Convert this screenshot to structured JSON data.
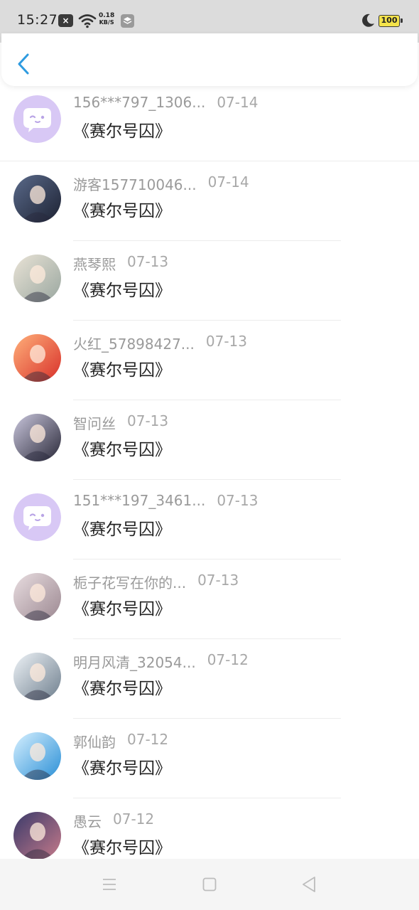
{
  "status_bar": {
    "time": "15:27",
    "speed_value": "0.18",
    "speed_unit": "KB/S",
    "battery": "100",
    "icons": [
      "notification-x-icon",
      "wifi-icon",
      "layers-icon",
      "moon-icon",
      "battery-icon"
    ]
  },
  "header": {
    "back_icon": "chevron-left-icon",
    "accent_color": "#2e9be0"
  },
  "items": [
    {
      "name": "156***797_1306...",
      "date": "07-14",
      "message": "《赛尔号囚》",
      "avatar": "default-chat-avatar"
    },
    {
      "name": "游客157710046...",
      "date": "07-14",
      "message": "《赛尔号囚》",
      "avatar": "user-photo-avatar"
    },
    {
      "name": "燕琴熙",
      "date": "07-13",
      "message": "《赛尔号囚》",
      "avatar": "user-photo-avatar"
    },
    {
      "name": "火红_57898427...",
      "date": "07-13",
      "message": "《赛尔号囚》",
      "avatar": "user-photo-avatar"
    },
    {
      "name": "智问丝",
      "date": "07-13",
      "message": "《赛尔号囚》",
      "avatar": "user-photo-avatar"
    },
    {
      "name": "151***197_3461...",
      "date": "07-13",
      "message": "《赛尔号囚》",
      "avatar": "default-chat-avatar"
    },
    {
      "name": "栀子花写在你的...",
      "date": "07-13",
      "message": "《赛尔号囚》",
      "avatar": "user-photo-avatar"
    },
    {
      "name": "明月风清_32054...",
      "date": "07-12",
      "message": "《赛尔号囚》",
      "avatar": "user-photo-avatar"
    },
    {
      "name": "郭仙韵",
      "date": "07-12",
      "message": "《赛尔号囚》",
      "avatar": "user-photo-avatar"
    },
    {
      "name": "愚云",
      "date": "07-12",
      "message": "《赛尔号囚》",
      "avatar": "user-photo-avatar"
    }
  ],
  "nav_bar": {
    "icons": [
      "menu-icon",
      "home-square-icon",
      "back-triangle-icon"
    ]
  }
}
